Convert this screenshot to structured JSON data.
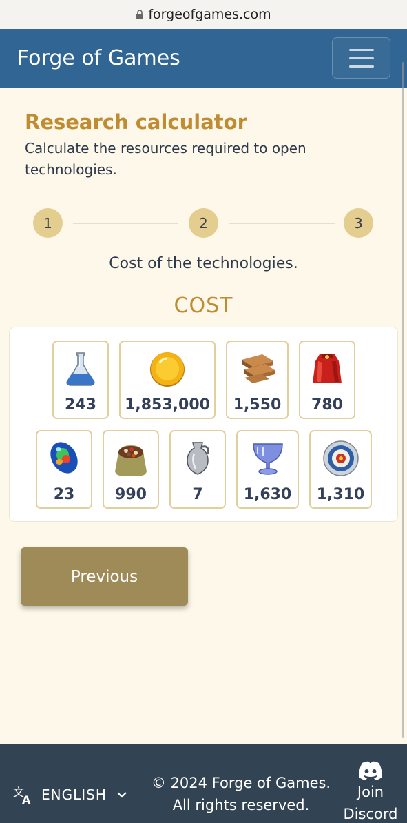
{
  "browser": {
    "url": "forgeofgames.com"
  },
  "navbar": {
    "brand": "Forge of Games"
  },
  "page": {
    "title": "Research calculator",
    "subtitle": "Calculate the resources required to open technologies."
  },
  "stepper": {
    "steps": [
      "1",
      "2",
      "3"
    ]
  },
  "cost": {
    "caption": "Cost of the technologies.",
    "header": "COST",
    "resources": [
      {
        "icon": "flask-icon",
        "value": "243"
      },
      {
        "icon": "coin-icon",
        "value": "1,853,000"
      },
      {
        "icon": "lumber-icon",
        "value": "1,550"
      },
      {
        "icon": "cloak-icon",
        "value": "780"
      },
      {
        "icon": "gem-icon",
        "value": "23"
      },
      {
        "icon": "sack-icon",
        "value": "990"
      },
      {
        "icon": "amphora-icon",
        "value": "7"
      },
      {
        "icon": "goblet-icon",
        "value": "1,630"
      },
      {
        "icon": "plate-icon",
        "value": "1,310"
      }
    ]
  },
  "buttons": {
    "previous": "Previous"
  },
  "footer": {
    "language": "ENGLISH",
    "copyright": "© 2024 Forge of Games. All rights reserved.",
    "discord": "Join Discord"
  },
  "colors": {
    "navbar": "#316593",
    "accent": "#c08c32",
    "button": "#9f8b57",
    "footer": "#324353",
    "background": "#fdf8ea"
  }
}
